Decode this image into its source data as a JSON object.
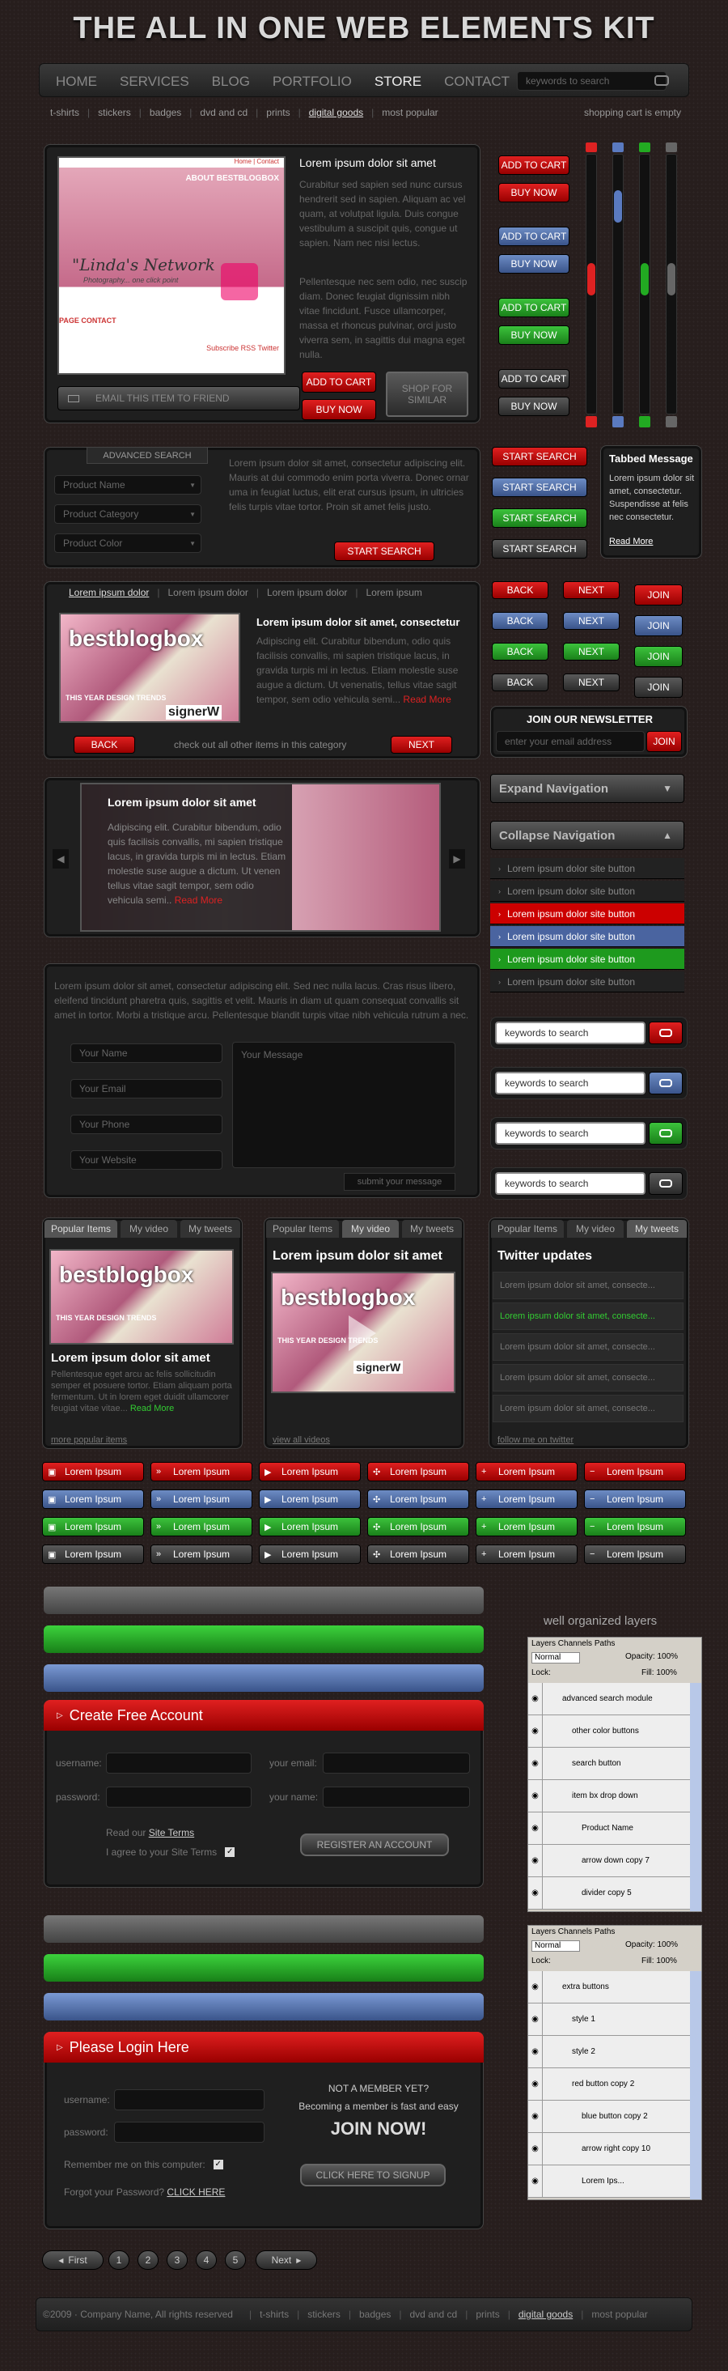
{
  "kit_title": "THE ALL IN ONE WEB ELEMENTS KIT",
  "nav": {
    "items": [
      "HOME",
      "SERVICES",
      "BLOG",
      "PORTFOLIO",
      "STORE",
      "CONTACT"
    ],
    "search_placeholder": "keywords to search"
  },
  "subnav": {
    "items": [
      "t-shirts",
      "stickers",
      "badges",
      "dvd and cd",
      "prints",
      "digital goods",
      "most popular"
    ],
    "cart": "shopping cart is empty"
  },
  "product": {
    "title": "Lorem ipsum dolor sit amet",
    "p1": "Curabitur sed sapien sed nunc cursus hendrerit sed in sapien. Aliquam ac vel quam, at volutpat ligula. Duis congue vestibulum a suscipit quis, congue ut sapien. Nam nec nisi lectus.",
    "p2": "Pellentesque nec sem odio, nec suscip diam. Donec feugiat dignissim nibh vitae fincidunt. Fusce ullamcorper, massa et rhoncus pulvinar, orci justo viverra sem, in sagittis dui magna eget nulla.",
    "email_btn": "EMAIL THIS ITEM TO FRIEND",
    "add_cart": "ADD TO CART",
    "buy_now": "BUY NOW",
    "shop_similar": "SHOP FOR SIMILAR",
    "thumb_tagline": "\"Linda's Network",
    "thumb_sub": "Photography... one click point",
    "thumb_nav": "Home | Contact",
    "thumb_about": "ABOUT BESTBLOGBOX",
    "thumb_links": "PAGE    CONTACT",
    "thumb_subscribe": "Subscribe RSS  Twitter"
  },
  "cart_buttons": [
    {
      "a": "ADD TO CART",
      "b": "BUY NOW",
      "c": "red"
    },
    {
      "a": "ADD TO CART",
      "b": "BUY NOW",
      "c": "blue"
    },
    {
      "a": "ADD TO CART",
      "b": "BUY NOW",
      "c": "green"
    },
    {
      "a": "ADD TO CART",
      "b": "BUY NOW",
      "c": "dark"
    }
  ],
  "sliders": {
    "labels": [
      "R",
      "B",
      "G",
      "K"
    ]
  },
  "adv_search": {
    "title": "ADVANCED SEARCH",
    "fields": [
      "Product Name",
      "Product Category",
      "Product Color"
    ],
    "text": "Lorem ipsum dolor sit amet, consectetur adipiscing elit. Mauris at dui commodo enim porta viverra. Donec ornar uma in feugiat luctus, elit erat cursus ipsum, in ultricies felis turpis vitae tortor. Proin sit amet felis justo.",
    "button": "START SEARCH"
  },
  "search_buttons": [
    "START SEARCH",
    "START SEARCH",
    "START SEARCH",
    "START SEARCH"
  ],
  "tabbed": {
    "title": "Tabbed Message",
    "text": "Lorem ipsum dolor sit amet, consectetur. Suspendisse at felis nec consectetur.",
    "link": "Read More"
  },
  "gallery": {
    "tabs": [
      "Lorem ipsum dolor",
      "Lorem ipsum dolor",
      "Lorem ipsum dolor",
      "Lorem ipsum"
    ],
    "title": "Lorem ipsum dolor sit amet, consectetur",
    "text": "Adipiscing elit. Curabitur bibendum, odio quis facilisis convallis, mi sapien tristique lacus, in gravida turpis mi in lectus. Etiam molestie suse augue a dictum. Ut venenatis, tellus vitae sagit tempor, sem odio vehicula semi... ",
    "read": "Read More",
    "back": "BACK",
    "next": "NEXT",
    "footer": "check out all other items in this category",
    "logo": "bestblogbox",
    "trends": "THIS YEAR DESIGN TRENDS",
    "signer": "signerW"
  },
  "nav_buttons": {
    "back": "BACK",
    "next": "NEXT",
    "join": "JOIN"
  },
  "newsletter": {
    "title": "JOIN OUR NEWSLETTER",
    "placeholder": "enter your email address",
    "button": "JOIN"
  },
  "slider2": {
    "title": "Lorem ipsum dolor sit amet",
    "text": "Adipiscing elit. Curabitur bibendum, odio quis facilisis convallis, mi sapien tristique lacus, in gravida turpis mi in lectus. Etiam molestie suse augue a dictum. Ut venen tellus vitae sagit tempor, sem odio vehicula semi.. ",
    "read": "Read More"
  },
  "accordion": {
    "expand": "Expand Navigation",
    "collapse": "Collapse Navigation",
    "items": [
      "Lorem ipsum dolor site button",
      "Lorem ipsum dolor site button",
      "Lorem ipsum dolor site button",
      "Lorem ipsum dolor site button",
      "Lorem ipsum dolor site button",
      "Lorem ipsum dolor site button"
    ]
  },
  "contact": {
    "text": "Lorem ipsum dolor sit amet, consectetur adipiscing elit. Sed nec nulla lacus. Cras risus libero, eleifend tincidunt pharetra quis, sagittis et velit. Mauris in diam ut quam consequat convallis sit amet in tortor. Morbi a tristique arcu. Pellentesque blandit turpis vitae nibh vehicula rutrum a nec.",
    "fields": [
      "Your Name",
      "Your Email",
      "Your Phone",
      "Your Website"
    ],
    "message": "Your Message",
    "submit": "submit your message"
  },
  "searches": [
    "keywords to search",
    "keywords to search",
    "keywords to search",
    "keywords to search"
  ],
  "widgets": {
    "tabs": [
      "Popular Items",
      "My video",
      "My tweets"
    ],
    "w1_title": "Lorem ipsum dolor sit amet",
    "w1_text": "Pellentesque eget arcu ac felis sollicitudin semper et posuere tortor. Etiam aliquam porta fermentum. Ut in lorem eget duidit ullamcorer feugiat vitae vitae... ",
    "w1_read": "Read More",
    "w1_more": "more popular items",
    "w2_title": "Lorem ipsum dolor sit amet",
    "w2_more": "view all videos",
    "w3_title": "Twitter updates",
    "tweets": [
      "Lorem ipsum dolor sit amet, consecte...",
      "Lorem ipsum dolor sit amet, consecte...",
      "Lorem ipsum dolor sit amet, consecte...",
      "Lorem ipsum dolor sit amet, consecte...",
      "Lorem ipsum dolor sit amet, consecte..."
    ],
    "w3_more": "follow me on twitter"
  },
  "icon_buttons": {
    "label": "Lorem Ipsum"
  },
  "layers_title": "well organized layers",
  "layers1": {
    "tabs": "Layers  Channels  Paths",
    "mode": "Normal",
    "opacity": "Opacity: 100%",
    "lock": "Lock:",
    "fill": "Fill: 100%",
    "rows": [
      "advanced search module",
      "other color buttons",
      "search button",
      "item bx drop down",
      "Product Name",
      "arrow down copy 7",
      "divider copy 5"
    ]
  },
  "layers2": {
    "tabs": "Layers  Channels  Paths",
    "mode": "Normal",
    "opacity": "Opacity: 100%",
    "lock": "Lock:",
    "fill": "Fill: 100%",
    "rows": [
      "extra buttons",
      "style 1",
      "style 2",
      "red button copy 2",
      "blue button copy 2",
      "arrow right copy 10",
      "Lorem Ips..."
    ]
  },
  "create": {
    "title": "Create Free Account",
    "username": "username:",
    "password": "password:",
    "email": "your email:",
    "name": "your name:",
    "read": "Read our ",
    "terms": "Site Terms",
    "agree": "I agree to your Site Terms",
    "register": "REGISTER AN ACCOUNT"
  },
  "login": {
    "title": "Please Login Here",
    "username": "username:",
    "password": "password:",
    "remember": "Remember me on this computer:",
    "forgot": "Forgot your Password?",
    "click": "CLICK HERE",
    "not_member": "NOT A MEMBER YET?",
    "fast": "Becoming a member is fast and easy",
    "join": "JOIN NOW!",
    "signup": "CLICK HERE TO SIGNUP"
  },
  "pagination": {
    "first": "First",
    "pages": [
      "1",
      "2",
      "3",
      "4",
      "5"
    ],
    "next": "Next"
  },
  "footer": {
    "copy": "©2009 · Company Name, All rights reserved",
    "items": [
      "t-shirts",
      "stickers",
      "badges",
      "dvd and cd",
      "prints",
      "digital goods",
      "most popular"
    ]
  }
}
